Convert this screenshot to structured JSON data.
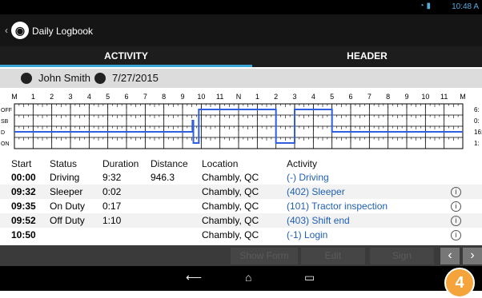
{
  "status_bar": {
    "time": "10:48 A"
  },
  "app": {
    "title": "Daily Logbook"
  },
  "tabs": [
    {
      "label": "ACTIVITY"
    },
    {
      "label": "HEADER"
    }
  ],
  "driver": {
    "name": "John Smith",
    "date": "7/27/2015"
  },
  "graph": {
    "hour_labels": [
      "M",
      "1",
      "2",
      "3",
      "4",
      "5",
      "6",
      "7",
      "8",
      "9",
      "10",
      "11",
      "N",
      "1",
      "2",
      "3",
      "4",
      "5",
      "6",
      "7",
      "8",
      "9",
      "10",
      "11",
      "M"
    ],
    "rows": [
      "OFF",
      "SB",
      "D",
      "ON"
    ],
    "totals": [
      "6:",
      "0:",
      "16:",
      "1:"
    ],
    "line_color": "#2f5fe0"
  },
  "table": {
    "headers": [
      "Start",
      "Status",
      "Duration",
      "Distance",
      "Location",
      "Activity"
    ],
    "rows": [
      {
        "start": "00:00",
        "status": "Driving",
        "duration": "9:32",
        "distance": "946.3",
        "location": "Chambly, QC",
        "activity": "(-) Driving",
        "info": ""
      },
      {
        "start": "09:32",
        "status": "Sleeper",
        "duration": "0:02",
        "distance": "",
        "location": "Chambly, QC",
        "activity": "(402) Sleeper",
        "info": "i"
      },
      {
        "start": "09:35",
        "status": "On Duty",
        "duration": "0:17",
        "distance": "",
        "location": "Chambly, QC",
        "activity": "(101) Tractor inspection",
        "info": "i"
      },
      {
        "start": "09:52",
        "status": "Off Duty",
        "duration": "1:10",
        "distance": "",
        "location": "Chambly, QC",
        "activity": "(403) Shift end",
        "info": "i"
      },
      {
        "start": "10:50",
        "status": "",
        "duration": "",
        "distance": "",
        "location": "Chambly, QC",
        "activity": "(-1) Login",
        "info": "i"
      }
    ]
  },
  "actions": {
    "show_form": "Show Form",
    "edit": "Edit",
    "sign": "Sign",
    "prev": "‹",
    "next": "›"
  },
  "badge": "4",
  "nav": {
    "back": "⟵",
    "home": "⌂",
    "recents": "▭"
  }
}
